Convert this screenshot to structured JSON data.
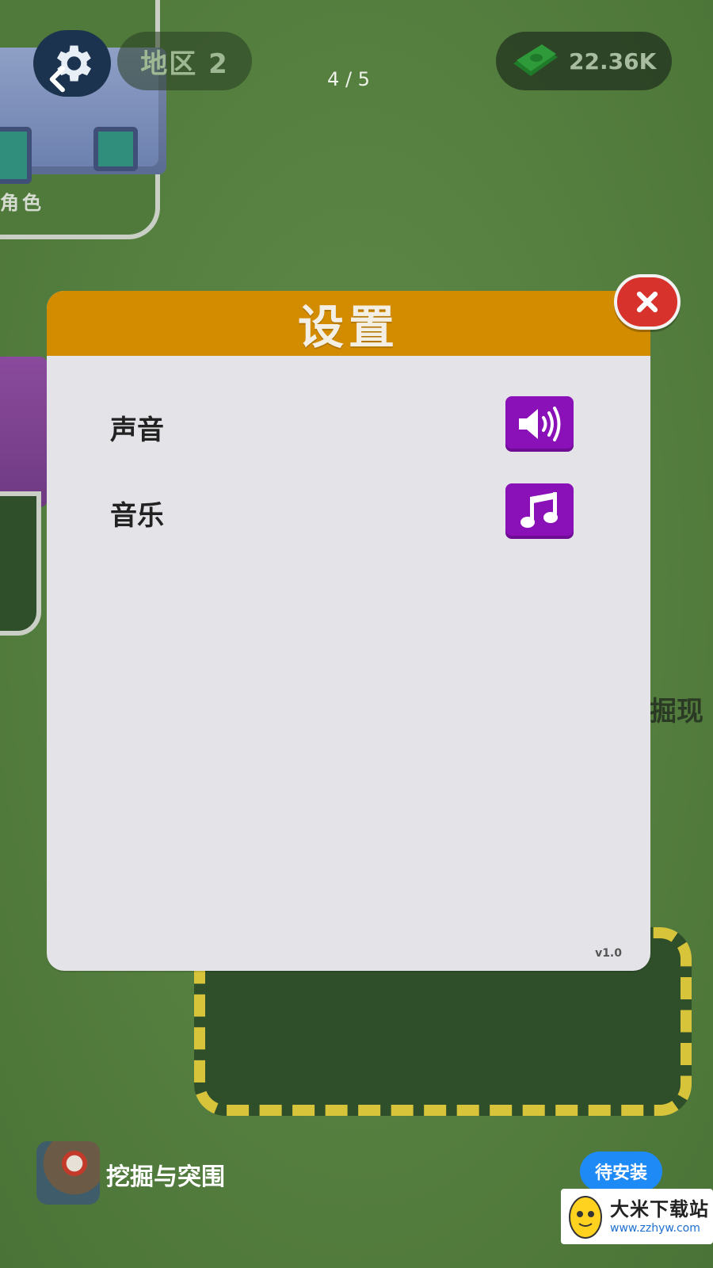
{
  "hud": {
    "back_icon": "chevron-left-icon",
    "settings_icon": "gear-icon",
    "region_label": "地区 2",
    "page_indicator": "4 / 5",
    "money_icon": "cash-icon",
    "money_value": "22.36K"
  },
  "scene": {
    "role_text": "角色",
    "partial_text": "掘现"
  },
  "modal": {
    "title": "设置",
    "rows": [
      {
        "label": "声音",
        "icon": "speaker-icon"
      },
      {
        "label": "音乐",
        "icon": "music-note-icon"
      }
    ],
    "version": "v1.0",
    "close_icon": "close-icon"
  },
  "ad": {
    "app_name": "挖掘与突围",
    "install_label": "待安装"
  },
  "watermark": {
    "title": "大米下载站",
    "url": "www.zzhyw.com"
  },
  "colors": {
    "header_orange": "#d38b00",
    "toggle_purple": "#8a10b8",
    "close_red": "#d8322c",
    "install_blue": "#1e8af5"
  }
}
